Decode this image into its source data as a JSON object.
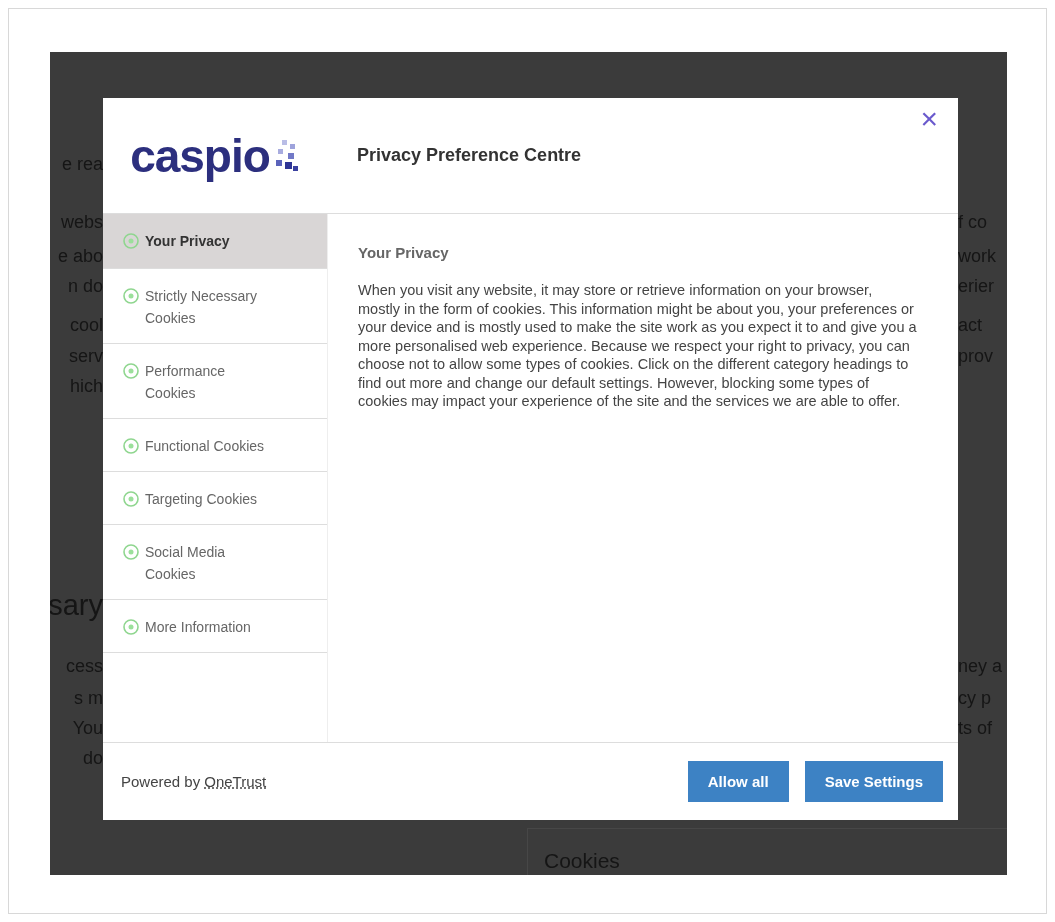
{
  "background_page": {
    "left_fragments": [
      {
        "text": "e rea",
        "kind": "body"
      },
      {
        "text": "webs",
        "kind": "body"
      },
      {
        "text": "e abo",
        "kind": "body"
      },
      {
        "text": "n do",
        "kind": "body"
      },
      {
        "text": "cool",
        "kind": "body"
      },
      {
        "text": "serv",
        "kind": "body"
      },
      {
        "text": "hich",
        "kind": "body"
      },
      {
        "text": "sary",
        "kind": "heading"
      },
      {
        "text": "cess",
        "kind": "body"
      },
      {
        "text": "s m",
        "kind": "body"
      },
      {
        "text": "You",
        "kind": "body"
      },
      {
        "text": "do",
        "kind": "body"
      }
    ],
    "right_fragments": [
      {
        "text": "f co"
      },
      {
        "text": "work"
      },
      {
        "text": "erier"
      },
      {
        "text": "act"
      },
      {
        "text": "prov"
      },
      {
        "text": "ney a"
      },
      {
        "text": "cy p"
      },
      {
        "text": "ts of"
      }
    ],
    "table_header": "Cookies"
  },
  "dialog": {
    "logo": "caspio",
    "title": "Privacy Preference Centre",
    "close": "×",
    "menu": [
      {
        "label": "Your Privacy",
        "selected": true
      },
      {
        "label": "Strictly Necessary Cookies",
        "selected": false
      },
      {
        "label": "Performance Cookies",
        "selected": false
      },
      {
        "label": "Functional Cookies",
        "selected": false
      },
      {
        "label": "Targeting Cookies",
        "selected": false
      },
      {
        "label": "Social Media Cookies",
        "selected": false
      },
      {
        "label": "More Information",
        "selected": false
      }
    ],
    "content": {
      "heading": "Your Privacy",
      "body": "When you visit any website, it may store or retrieve information on your browser, mostly in the form of cookies. This information might be about you, your preferences or your device and is mostly used to make the site work as you expect it to and give you a more personalised web experience. Because we respect your right to privacy, you can choose not to allow some types of cookies. Click on the different category headings to find out more and change our default settings. However, blocking some types of cookies may impact your experience of the site and the services we are able to offer."
    },
    "footer": {
      "powered_by": "Powered by",
      "brand": "OneTrust",
      "buttons": [
        "Allow all",
        "Save Settings"
      ]
    }
  }
}
